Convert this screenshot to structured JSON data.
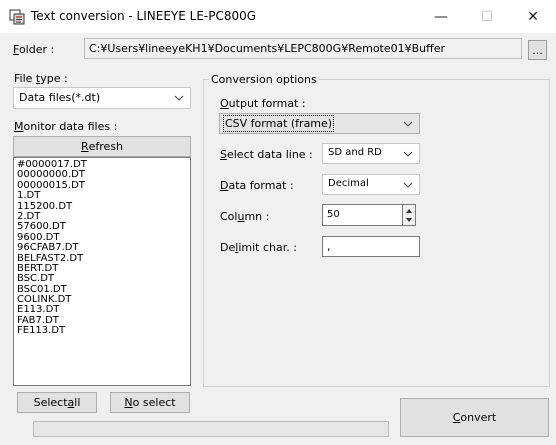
{
  "window": {
    "title": "Text conversion - LINEEYE LE-PC800G",
    "controls": {
      "minimize": "—",
      "maximize": "☐",
      "close": "✕"
    }
  },
  "folder": {
    "label_prefix": "F",
    "label_rest": "older :",
    "path": "C:¥Users¥lineeyeKH1¥Documents¥LEPC800G¥Remote01¥Buffer",
    "browse_label": "..."
  },
  "file_type": {
    "label_pre": "File ",
    "label_key": "t",
    "label_post": "ype :",
    "selected": "Data files(*.dt)"
  },
  "monitor_files": {
    "label_key": "M",
    "label_rest": "onitor data files :",
    "refresh_key": "R",
    "refresh_rest": "efresh",
    "files": [
      "#0000017.DT",
      "00000000.DT",
      "00000015.DT",
      "1.DT",
      "115200.DT",
      "2.DT",
      "57600.DT",
      "9600.DT",
      "96CFAB7.DT",
      "BELFAST2.DT",
      "BERT.DT",
      "BSC.DT",
      "BSC01.DT",
      "COLINK.DT",
      "E113.DT",
      "FAB7.DT",
      "FE113.DT"
    ],
    "select_all_pre": "Select ",
    "select_all_key": "a",
    "select_all_post": "ll",
    "no_select_key": "N",
    "no_select_rest": "o select"
  },
  "conversion": {
    "group_title": "Conversion options",
    "output_format_key": "O",
    "output_format_rest": "utput format :",
    "output_format_value": "CSV format (frame)",
    "data_line_key": "S",
    "data_line_rest": "elect data line :",
    "data_line_value": "SD and RD",
    "data_format_key": "D",
    "data_format_rest": "ata format :",
    "data_format_value": "Decimal",
    "column_pre": "Col",
    "column_key": "u",
    "column_post": "mn :",
    "column_value": "50",
    "delimit_pre": "De",
    "delimit_key": "l",
    "delimit_post": "imit char. :",
    "delimit_value": ","
  },
  "convert": {
    "key": "C",
    "rest": "onvert"
  },
  "progress": {
    "value_percent": 0
  },
  "colors": {
    "focus": "#0078d7",
    "border": "#7a7a7a",
    "button": "#e1e1e1"
  }
}
